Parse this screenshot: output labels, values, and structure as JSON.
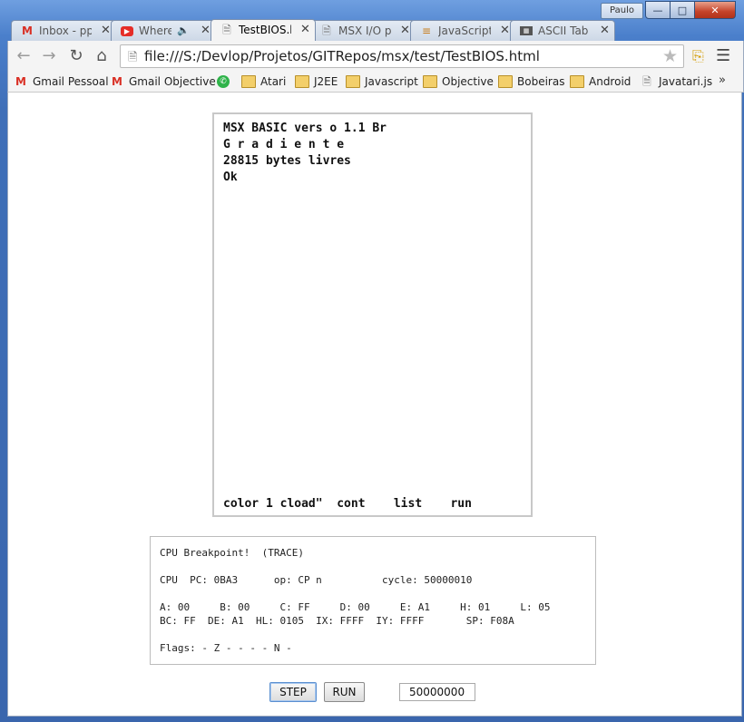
{
  "window": {
    "profile_name": "Paulo",
    "minimize_icon": "minimize-icon",
    "maximize_icon": "maximize-icon",
    "close_icon": "close-icon"
  },
  "tabs": [
    {
      "label": "Inbox - pp",
      "icon": "gmail-icon",
      "icon_color": "#d93025"
    },
    {
      "label": "Where",
      "icon": "youtube-icon",
      "icon_color": "#e52d27",
      "audio": true
    },
    {
      "label": "TestBIOS.h",
      "icon": "page-icon",
      "active": true
    },
    {
      "label": "MSX I/O p",
      "icon": "page-icon"
    },
    {
      "label": "JavaScript",
      "icon": "stackoverflow-icon",
      "icon_color": "#c77c1a"
    },
    {
      "label": "ASCII Tab",
      "icon": "ascii-icon"
    }
  ],
  "toolbar": {
    "url": "file:///S:/Devlop/Projetos/GITRepos/msx/test/TestBIOS.html"
  },
  "bookmarks": [
    {
      "label": "Gmail Pessoal",
      "icon": "gmail-icon"
    },
    {
      "label": "Gmail Objective",
      "icon": "gmail-icon"
    },
    {
      "label": "",
      "icon": "whatsapp-icon"
    },
    {
      "label": "Atari",
      "icon": "folder-icon"
    },
    {
      "label": "J2EE",
      "icon": "folder-icon"
    },
    {
      "label": "Javascript",
      "icon": "folder-icon"
    },
    {
      "label": "Objective",
      "icon": "folder-icon"
    },
    {
      "label": "Bobeiras",
      "icon": "folder-icon"
    },
    {
      "label": "Android",
      "icon": "folder-icon"
    },
    {
      "label": "Javatari.js",
      "icon": "page-icon"
    }
  ],
  "bookmarks_more": "»",
  "msx_screen": {
    "lines": [
      "MSX BASIC vers o 1.1 Br",
      "G r a d i e n t e",
      "28815 bytes livres",
      "Ok"
    ],
    "function_keys": "color 1 cload\"  cont    list    run"
  },
  "debugger": {
    "lines": [
      "CPU Breakpoint!  (TRACE)",
      "CPU  PC: 0BA3      op: CP n          cycle: 50000010",
      "A: 00     B: 00     C: FF     D: 00     E: A1     H: 01     L: 05",
      "BC: FF  DE: A1  HL: 0105  IX: FFFF  IY: FFFF       SP: F08A",
      "Flags: - Z - - - - N -"
    ]
  },
  "controls": {
    "step_label": "STEP",
    "run_label": "RUN",
    "cycles_value": "50000000"
  }
}
